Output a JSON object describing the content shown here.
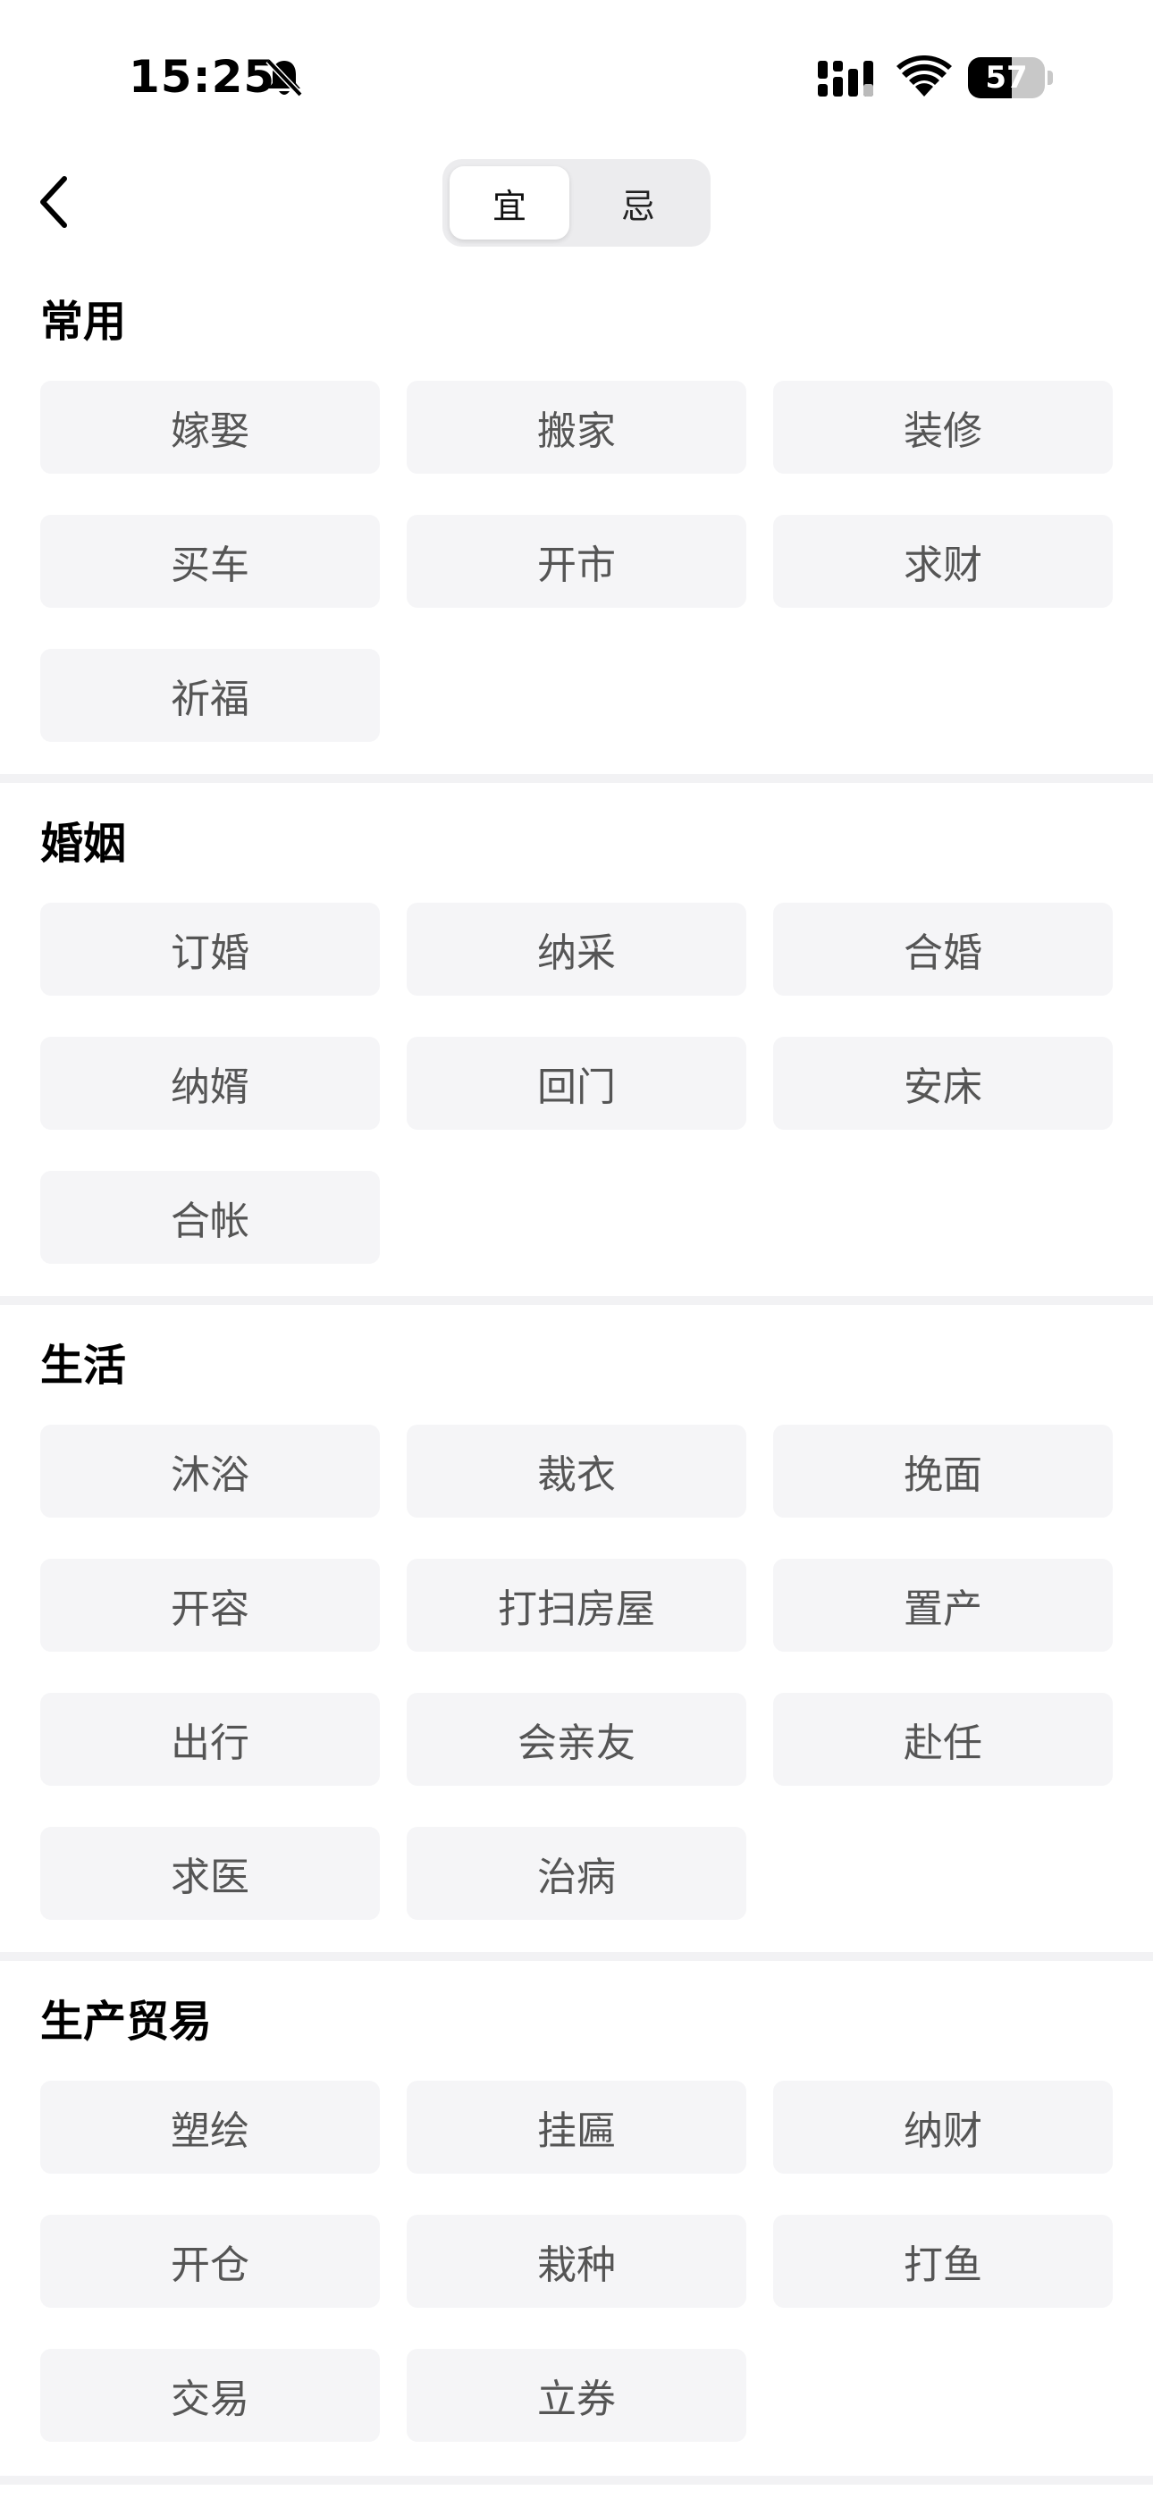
{
  "status_bar": {
    "time": "15:25",
    "battery": "57",
    "battery_level": 0.57
  },
  "nav": {
    "tabs": [
      {
        "label": "宜",
        "active": true
      },
      {
        "label": "忌",
        "active": false
      }
    ]
  },
  "sections": [
    {
      "title": "常用",
      "items": [
        "嫁娶",
        "搬家",
        "装修",
        "买车",
        "开市",
        "求财",
        "祈福"
      ]
    },
    {
      "title": "婚姻",
      "items": [
        "订婚",
        "纳采",
        "合婚",
        "纳婿",
        "回门",
        "安床",
        "合帐"
      ]
    },
    {
      "title": "生活",
      "items": [
        "沐浴",
        "裁衣",
        "挽面",
        "开容",
        "打扫房屋",
        "置产",
        "出行",
        "会亲友",
        "赴任",
        "求医",
        "治病"
      ]
    },
    {
      "title": "生产贸易",
      "items": [
        "塑绘",
        "挂匾",
        "纳财",
        "开仓",
        "栽种",
        "打鱼",
        "交易",
        "立券"
      ]
    }
  ],
  "colors": {
    "chip_bg": "#f5f5f7",
    "chip_text": "#555555",
    "divider": "#f2f2f4",
    "segment_bg": "#ececee"
  }
}
